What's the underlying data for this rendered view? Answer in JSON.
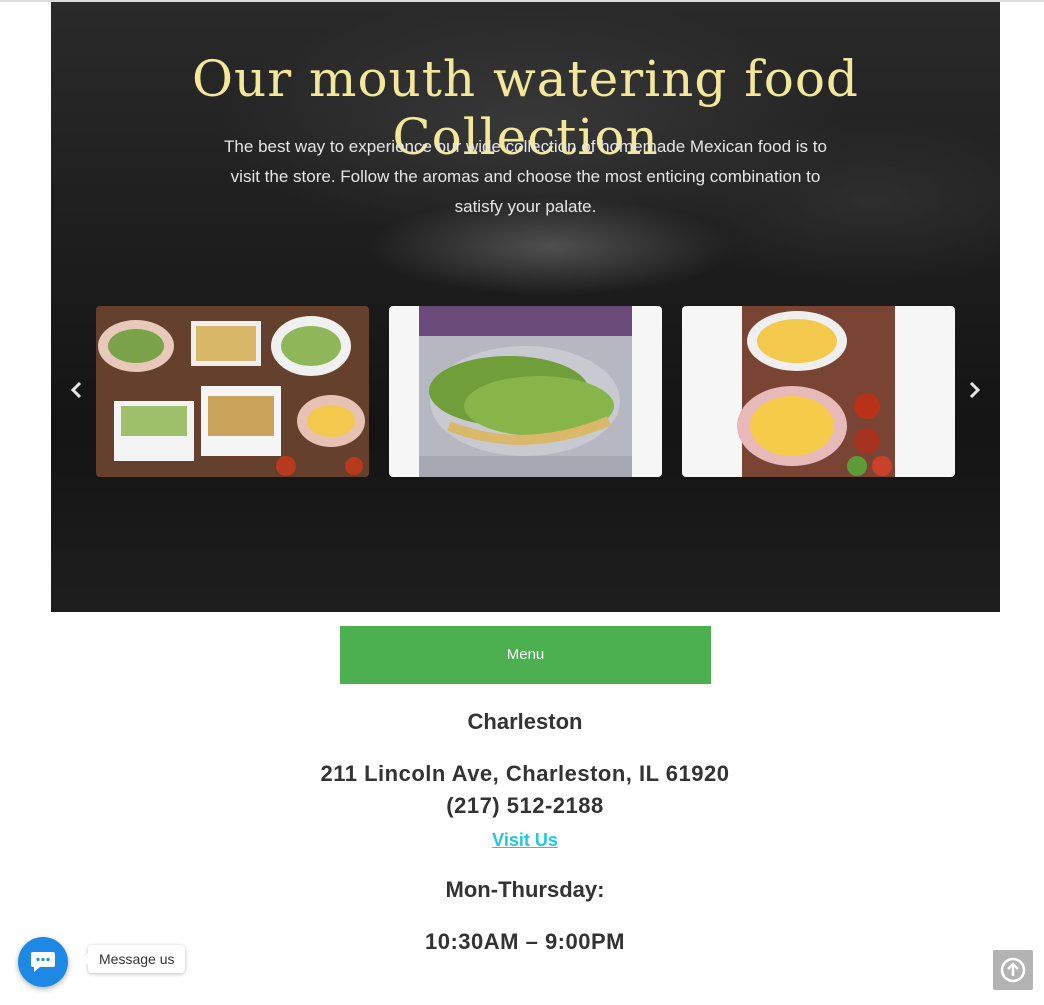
{
  "hero": {
    "title": "Our mouth watering food Collection",
    "subtitle": "The best way to experience our wide collection of homemade Mexican food is to visit the store. Follow the aromas and choose the most enticing combination to satisfy your palate.",
    "prev_icon": "chevron-left-icon",
    "next_icon": "chevron-right-icon"
  },
  "menu_button": {
    "label": "Menu",
    "color": "#4caf50"
  },
  "location": {
    "name": "Charleston",
    "address": "211 Lincoln Ave, Charleston, IL 61920",
    "phone": "(217) 512-2188",
    "visit_link": "Visit Us",
    "days": "Mon-Thursday:",
    "hours": "10:30AM – 9:00PM"
  },
  "widgets": {
    "message_label": "Message us",
    "message_icon": "chat-bubble-icon",
    "scroll_top_icon": "arrow-up-circle-icon"
  },
  "colors": {
    "link": "#1ec8e6",
    "title": "#f2e79a",
    "message": "#1e88e5"
  }
}
